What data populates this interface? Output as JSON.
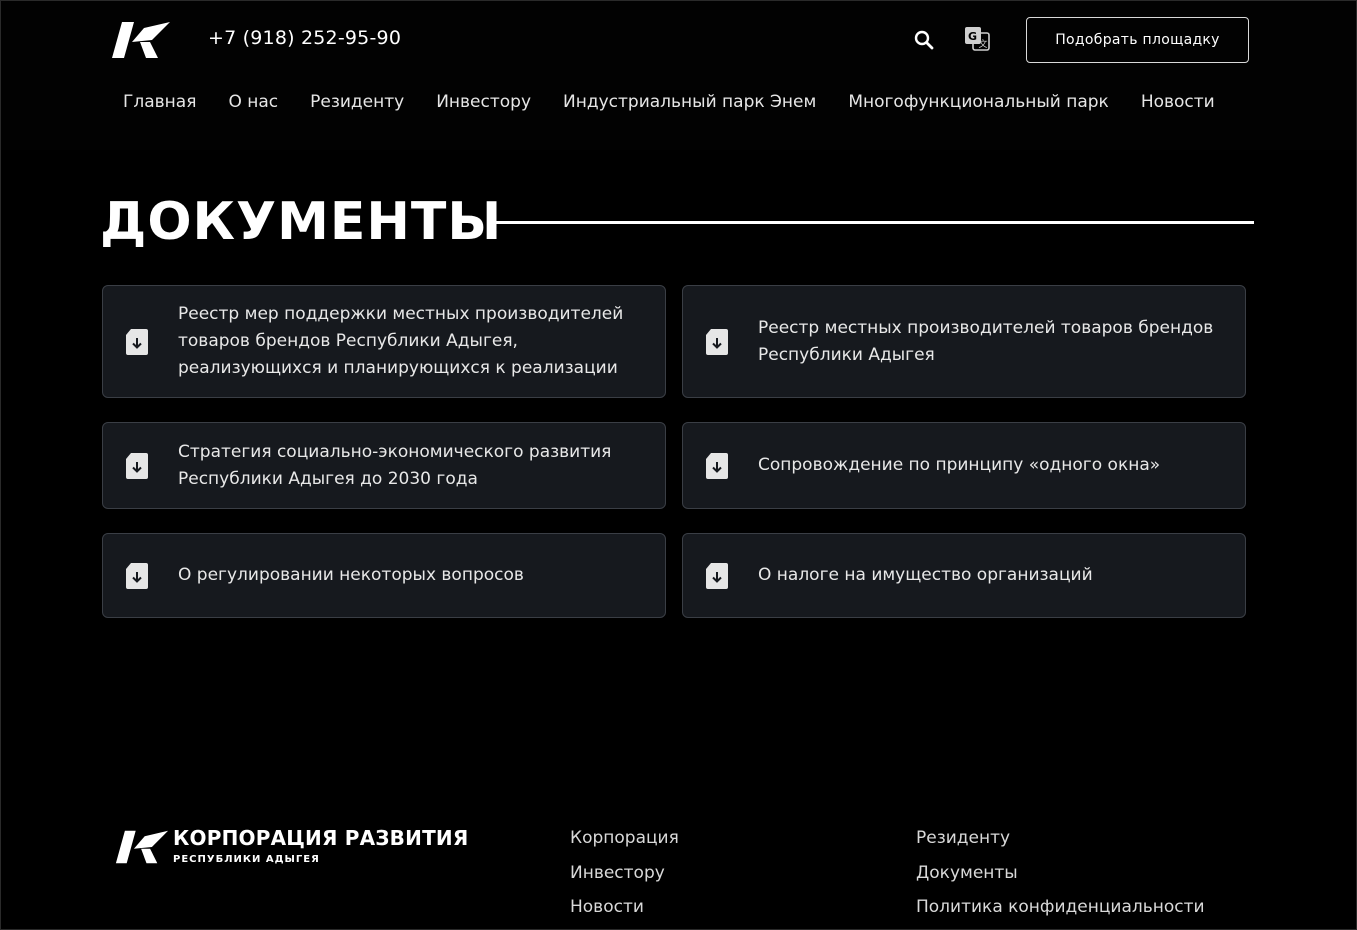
{
  "header": {
    "phone": "+7 (918) 252-95-90",
    "cta_label": "Подобрать площадку",
    "search_icon": "search-icon",
    "translate_icon": "google-translate-icon"
  },
  "nav": [
    "Главная",
    "О нас",
    "Резиденту",
    "Инвестору",
    "Индустриальный парк Энем",
    "Многофункциональный парк",
    "Новости"
  ],
  "page_title": "ДОКУМЕНТЫ",
  "documents": [
    "Реестр мер поддержки местных производителей товаров брендов Республики Адыгея, реализующихся и планирующихся к реализации",
    "Реестр местных производителей товаров брендов Республики Адыгея",
    "Стратегия социально-экономического развития Республики Адыгея до 2030 года",
    "Сопровождение по принципу «одного окна»",
    "О регулировании некоторых вопросов",
    "О налоге на имущество организаций"
  ],
  "footer": {
    "logo_name": "КОРПОРАЦИЯ РАЗВИТИЯ",
    "logo_sub": "РЕСПУБЛИКИ АДЫГЕЯ",
    "col1": [
      "Корпорация",
      "Инвестору",
      "Новости"
    ],
    "col2": [
      "Резиденту",
      "Документы",
      "Политика конфиденциальности"
    ]
  },
  "colors": {
    "background": "#000000",
    "card": "#16191e",
    "card_border": "#3a3e45",
    "text": "#ffffff"
  }
}
